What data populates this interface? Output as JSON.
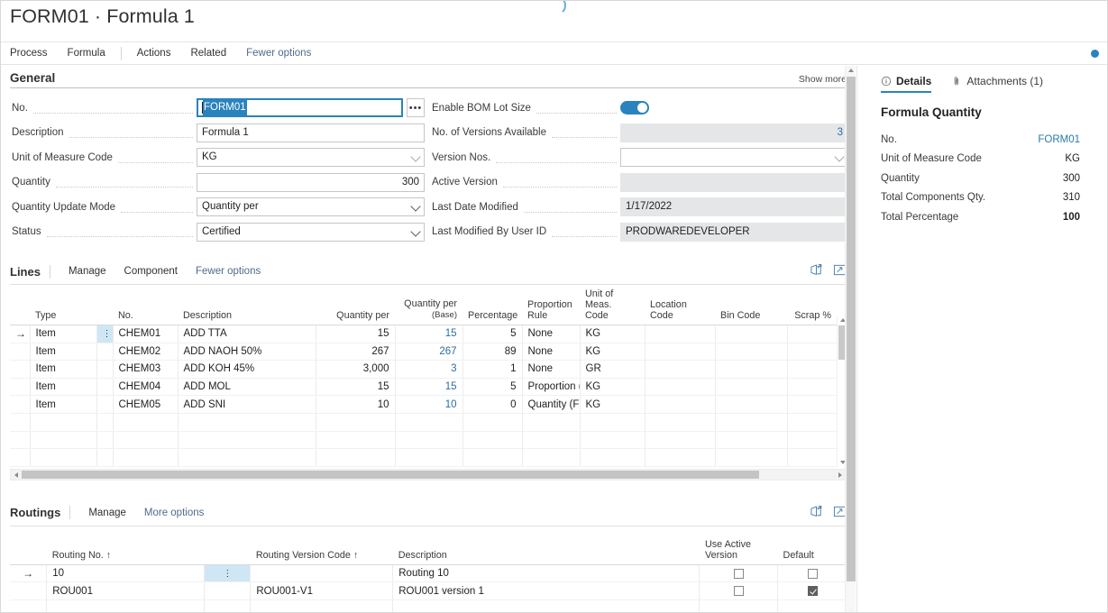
{
  "page": {
    "title": "FORM01 · Formula 1"
  },
  "ribbon": {
    "items": [
      {
        "label": "Process",
        "muted": false
      },
      {
        "label": "Formula",
        "muted": false
      },
      {
        "label": "Actions",
        "muted": false
      },
      {
        "label": "Related",
        "muted": false
      },
      {
        "label": "Fewer options",
        "muted": true
      }
    ],
    "indicator_color": "#2a83bd"
  },
  "general": {
    "title": "General",
    "show_more": "Show more",
    "left_fields": [
      {
        "label": "No.",
        "value": "FORM01",
        "type": "text-focused-selected",
        "has_ellipsis": true
      },
      {
        "label": "Description",
        "value": "Formula 1",
        "type": "text"
      },
      {
        "label": "Unit of Measure Code",
        "value": "KG",
        "type": "lookup"
      },
      {
        "label": "Quantity",
        "value": "300",
        "type": "number"
      },
      {
        "label": "Quantity Update Mode",
        "value": "Quantity per",
        "type": "dropdown"
      },
      {
        "label": "Status",
        "value": "Certified",
        "type": "dropdown"
      }
    ],
    "right_fields": [
      {
        "label": "Enable BOM Lot Size",
        "value": "",
        "type": "toggle",
        "toggle_on": true
      },
      {
        "label": "No. of Versions Available",
        "value": "3",
        "type": "readonly-number"
      },
      {
        "label": "Version Nos.",
        "value": "",
        "type": "lookup"
      },
      {
        "label": "Active Version",
        "value": "",
        "type": "readonly"
      },
      {
        "label": "Last Date Modified",
        "value": "1/17/2022",
        "type": "readonly-plain"
      },
      {
        "label": "Last Modified By User ID",
        "value": "PRODWAREDEVELOPER",
        "type": "readonly-plain"
      }
    ]
  },
  "lines": {
    "title": "Lines",
    "toolbar": [
      {
        "label": "Manage",
        "muted": false
      },
      {
        "label": "Component",
        "muted": false
      },
      {
        "label": "Fewer options",
        "muted": true
      }
    ],
    "icons": [
      "open-in-excel-icon",
      "expand-icon"
    ],
    "columns": [
      "Type",
      "No.",
      "Description",
      "Quantity per",
      "Quantity per (Base)",
      "Percentage",
      "Proportion Rule",
      "Unit of Meas. Code",
      "Location Code",
      "Bin Code",
      "Scrap %"
    ],
    "rows": [
      {
        "selected": true,
        "type": "Item",
        "no": "CHEM01",
        "description": "ADD TTA",
        "qty_per": "15",
        "qty_per_base": "15",
        "percentage": "5",
        "proportion_rule": "None",
        "uom": "KG",
        "location": "",
        "bin": "",
        "scrap": ""
      },
      {
        "selected": false,
        "type": "Item",
        "no": "CHEM02",
        "description": "ADD NAOH 50%",
        "qty_per": "267",
        "qty_per_base": "267",
        "percentage": "89",
        "proportion_rule": "None",
        "uom": "KG",
        "location": "",
        "bin": "",
        "scrap": ""
      },
      {
        "selected": false,
        "type": "Item",
        "no": "CHEM03",
        "description": "ADD KOH 45%",
        "qty_per": "3,000",
        "qty_per_base": "3",
        "percentage": "1",
        "proportion_rule": "None",
        "uom": "GR",
        "location": "",
        "bin": "",
        "scrap": ""
      },
      {
        "selected": false,
        "type": "Item",
        "no": "CHEM04",
        "description": "ADD MOL",
        "qty_per": "15",
        "qty_per_base": "15",
        "percentage": "5",
        "proportion_rule": "Proportion (...",
        "uom": "KG",
        "location": "",
        "bin": "",
        "scrap": ""
      },
      {
        "selected": false,
        "type": "Item",
        "no": "CHEM05",
        "description": "ADD SNI",
        "qty_per": "10",
        "qty_per_base": "10",
        "percentage": "0",
        "proportion_rule": "Quantity (Fi...",
        "uom": "KG",
        "location": "",
        "bin": "",
        "scrap": ""
      }
    ]
  },
  "routings": {
    "title": "Routings",
    "toolbar": [
      {
        "label": "Manage",
        "muted": false
      },
      {
        "label": "More options",
        "muted": true
      }
    ],
    "icons": [
      "open-in-excel-icon",
      "expand-icon"
    ],
    "columns": [
      "Routing No. ↑",
      "Routing Version Code ↑",
      "Description",
      "Use Active Version",
      "Default"
    ],
    "rows": [
      {
        "selected": true,
        "routing_no": "10",
        "version_code": "",
        "description": "Routing 10",
        "use_active_version": false,
        "default": false
      },
      {
        "selected": false,
        "routing_no": "ROU001",
        "version_code": "ROU001-V1",
        "description": "ROU001 version 1",
        "use_active_version": false,
        "default": true
      }
    ]
  },
  "factbox": {
    "tabs": [
      {
        "label": "Details",
        "icon": "info-icon",
        "active": true
      },
      {
        "label": "Attachments (1)",
        "icon": "attachment-icon",
        "active": false
      }
    ],
    "heading": "Formula Quantity",
    "rows": [
      {
        "key": "No.",
        "value": "FORM01",
        "style": "link"
      },
      {
        "key": "Unit of Measure Code",
        "value": "KG",
        "style": "plain"
      },
      {
        "key": "Quantity",
        "value": "300",
        "style": "plain"
      },
      {
        "key": "Total Components Qty.",
        "value": "310",
        "style": "plain"
      },
      {
        "key": "Total Percentage",
        "value": "100",
        "style": "bold"
      }
    ]
  }
}
